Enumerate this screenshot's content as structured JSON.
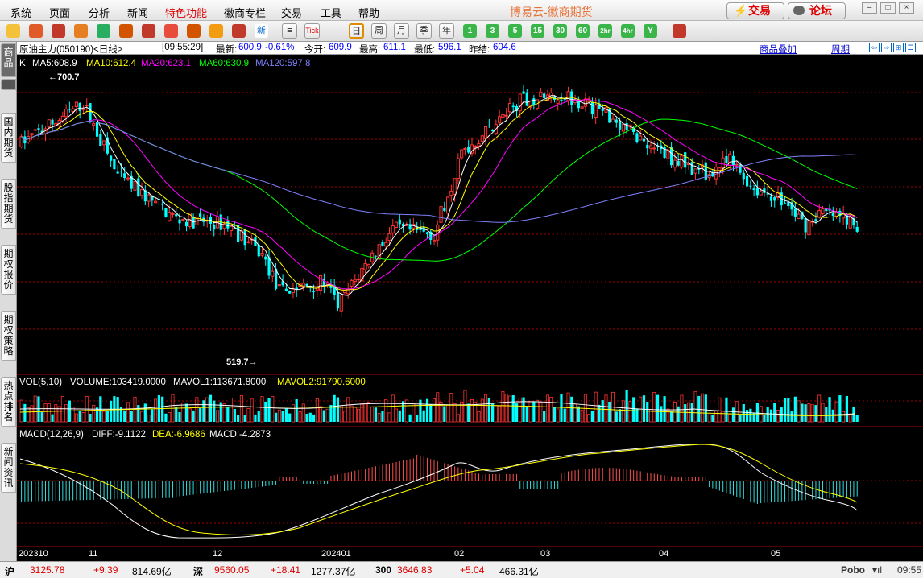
{
  "menu": {
    "items": [
      "系统",
      "页面",
      "分析",
      "新闻",
      "特色功能",
      "徽商专栏",
      "交易",
      "工具",
      "帮助"
    ],
    "brand": "博易云-徽商期货",
    "trade_btn": "交易",
    "forum_btn": "论坛"
  },
  "toolbar": {
    "period_labels": [
      "日",
      "周",
      "月",
      "季",
      "年",
      "1",
      "3",
      "5",
      "15",
      "30",
      "60",
      "2hr",
      "4hr",
      "Y"
    ],
    "tick_label": "Tick",
    "news_label": "新"
  },
  "left_tabs": [
    {
      "label": "商品",
      "selected": true
    },
    {
      "label": "国内期货"
    },
    {
      "label": "股指期货"
    },
    {
      "label": "期权报价"
    },
    {
      "label": "期权策略"
    },
    {
      "label": "热点排名"
    },
    {
      "label": "新闻资讯"
    }
  ],
  "info": {
    "symbol": "原油主力(050190)<日线>",
    "time": "[09:55:29]",
    "latest_label": "最新:",
    "latest": "600.9",
    "change": "-0.61%",
    "open_label": "今开:",
    "open": "609.9",
    "high_label": "最高:",
    "high": "611.1",
    "low_label": "最低:",
    "low": "596.1",
    "prev_label": "昨结:",
    "prev": "604.6",
    "overlay": "商品叠加",
    "period": "周期"
  },
  "chart_data": {
    "type": "candlestick",
    "price_panel": {
      "indicator_text": {
        "k": "K",
        "ma5": "MA5:608.9",
        "ma10": "MA10:612.4",
        "ma20": "MA20:623.1",
        "ma60": "MA60:630.9",
        "ma120": "MA120:597.8"
      },
      "high_mark": "←700.7",
      "low_mark": "519.7→",
      "high_value": 700.7,
      "low_value": 519.7,
      "ylim": [
        512,
        716
      ],
      "colors": {
        "up": "#ff3232",
        "down": "#00ffff",
        "ma5": "#ffffff",
        "ma10": "#ffff00",
        "ma20": "#ff00ff",
        "ma60": "#00ff00",
        "ma120": "#8080ff"
      }
    },
    "volume_panel": {
      "text": {
        "vol": "VOL(5,10)",
        "volume": "VOLUME:103419.0000",
        "mavol1": "MAVOL1:113671.8000",
        "mavol2": "MAVOL2:91790.6000"
      }
    },
    "macd_panel": {
      "text": {
        "macd": "MACD(12,26,9)",
        "diff": "DIFF:-9.1122",
        "dea": "DEA:-6.9686",
        "macd_val": "MACD:-4.2873"
      }
    },
    "x_tick_labels": [
      "202310",
      "11",
      "12",
      "202401",
      "02",
      "03",
      "04",
      "05"
    ]
  },
  "status": {
    "sh_label": "沪",
    "sh_index": "3125.78",
    "sh_change": "+9.39",
    "sh_amount": "814.69亿",
    "sz_label": "深",
    "sz_index": "9560.05",
    "sz_change": "+18.41",
    "sz_amount": "1277.37亿",
    "c300_label": "300",
    "c300_index": "3646.83",
    "c300_change": "+5.04",
    "c300_amount": "466.31亿",
    "brand": "Pobo",
    "clock": "09:55"
  }
}
